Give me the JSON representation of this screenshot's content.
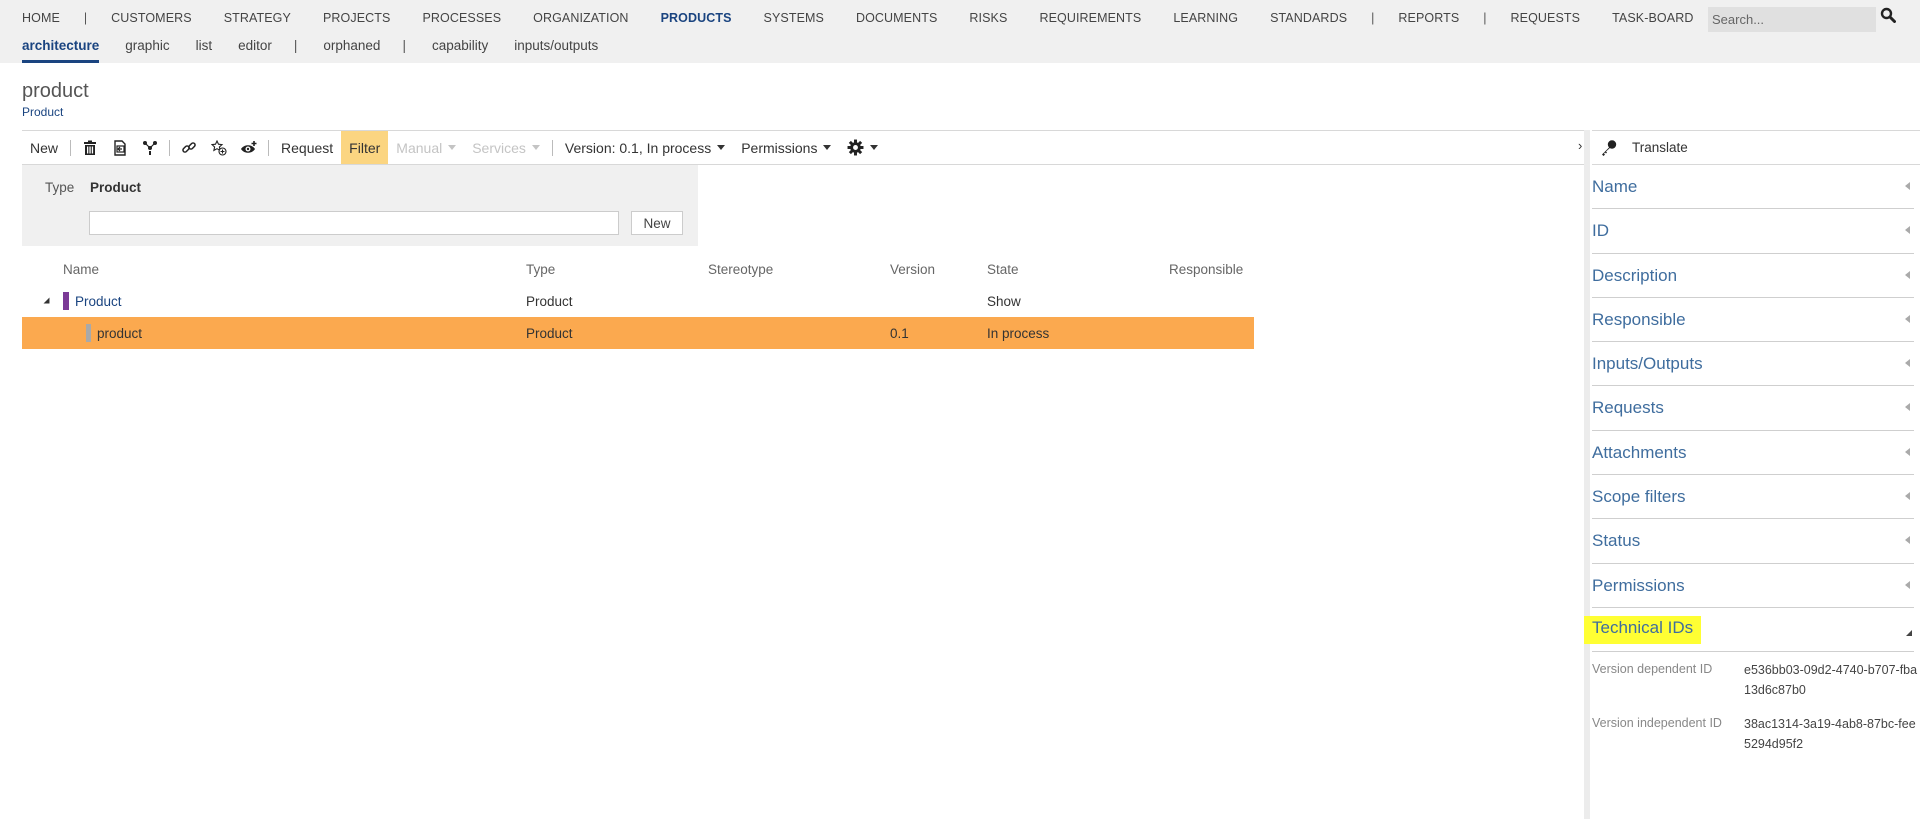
{
  "nav": {
    "main": [
      {
        "label": "HOME"
      },
      {
        "sep": "|"
      },
      {
        "label": "CUSTOMERS"
      },
      {
        "label": "STRATEGY"
      },
      {
        "label": "PROJECTS"
      },
      {
        "label": "PROCESSES"
      },
      {
        "label": "ORGANIZATION"
      },
      {
        "label": "PRODUCTS",
        "active": true
      },
      {
        "label": "SYSTEMS"
      },
      {
        "label": "DOCUMENTS"
      },
      {
        "label": "RISKS"
      },
      {
        "label": "REQUIREMENTS"
      },
      {
        "label": "LEARNING"
      },
      {
        "label": "STANDARDS"
      },
      {
        "sep": "|"
      },
      {
        "label": "REPORTS"
      },
      {
        "sep": "|"
      },
      {
        "label": "REQUESTS"
      },
      {
        "label": "TASK-BOARD"
      }
    ],
    "sub": [
      {
        "label": "architecture",
        "active": true
      },
      {
        "label": "graphic"
      },
      {
        "label": "list"
      },
      {
        "label": "editor"
      },
      {
        "sep": "|"
      },
      {
        "label": "orphaned"
      },
      {
        "sep": "|"
      },
      {
        "label": "capability"
      },
      {
        "label": "inputs/outputs"
      }
    ],
    "search_placeholder": "Search...",
    "search_icon": "search-icon"
  },
  "page": {
    "title": "product",
    "subtitle": "Product"
  },
  "toolbar": {
    "new_label": "New",
    "icons": [
      "trash-icon",
      "import-icon",
      "hierarchy-icon",
      "link-icon",
      "favorite-add-icon",
      "watch-add-icon"
    ],
    "request_label": "Request",
    "filter_label": "Filter",
    "manual_label": "Manual",
    "services_label": "Services",
    "version_label": "Version: 0.1, In process",
    "permissions_label": "Permissions",
    "settings_icon": "gear-icon",
    "collapse_icon": "chevron-right-icon"
  },
  "filter": {
    "type_label": "Type",
    "type_value": "Product",
    "input_value": "",
    "new_label": "New"
  },
  "grid": {
    "columns": [
      "Name",
      "Type",
      "Stereotype",
      "Version",
      "State",
      "Responsible"
    ],
    "rows": [
      {
        "name": "Product",
        "type": "Product",
        "stereotype": "",
        "version": "",
        "state": "Show",
        "responsible": "",
        "color": "#7b3a96",
        "expanded": true,
        "level": 0
      },
      {
        "name": "product",
        "type": "Product",
        "stereotype": "",
        "version": "0.1",
        "state": "In process",
        "responsible": "",
        "color": "#a9a9a9",
        "level": 1,
        "selected": true
      }
    ]
  },
  "details": {
    "translate_label": "Translate",
    "translate_icon": "key-icon",
    "sections": [
      "Name",
      "ID",
      "Description",
      "Responsible",
      "Inputs/Outputs",
      "Requests",
      "Attachments",
      "Scope filters",
      "Status",
      "Permissions",
      "Technical IDs"
    ],
    "open_section": "Technical IDs",
    "technical_ids": [
      {
        "label": "Version dependent ID",
        "value": "e536bb03-09d2-4740-b707-fba13d6c87b0"
      },
      {
        "label": "Version independent ID",
        "value": "38ac1314-3a19-4ab8-87bc-fee5294d95f2"
      }
    ]
  },
  "colors": {
    "accent": "#1a4480",
    "selected_row": "#fba94f",
    "filter_active": "#fbd581",
    "highlight": "#ffff33"
  }
}
